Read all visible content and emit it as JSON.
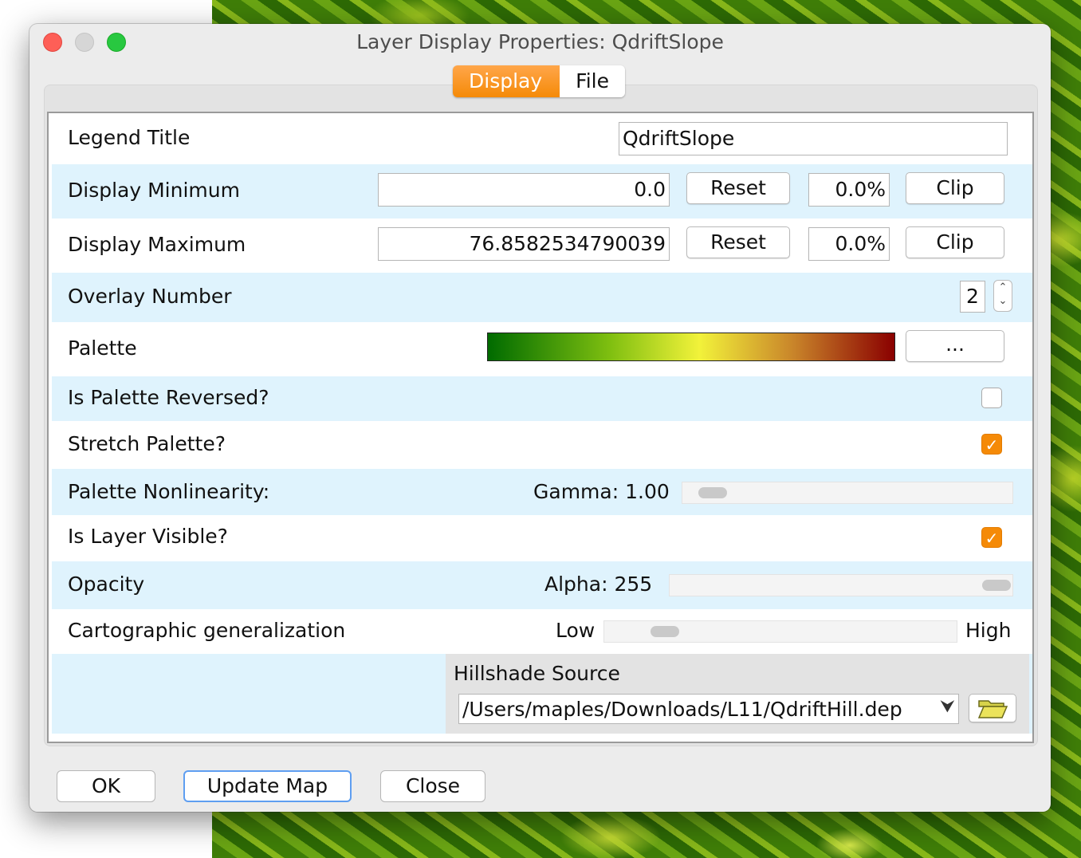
{
  "window": {
    "title": "Layer Display Properties: QdriftSlope"
  },
  "tabs": [
    {
      "label": "Display"
    },
    {
      "label": "File"
    }
  ],
  "legend_title": {
    "label": "Legend Title",
    "value": "QdriftSlope"
  },
  "display_minimum": {
    "label": "Display Minimum",
    "value": "0.0",
    "reset": "Reset",
    "percent": "0.0%",
    "clip": "Clip"
  },
  "display_maximum": {
    "label": "Display Maximum",
    "value": "76.8582534790039",
    "reset": "Reset",
    "percent": "0.0%",
    "clip": "Clip"
  },
  "overlay_number": {
    "label": "Overlay Number",
    "value": "2"
  },
  "palette": {
    "label": "Palette",
    "button": "...",
    "colors": [
      "#006b00",
      "#f2f23a",
      "#8a0000"
    ]
  },
  "palette_reversed": {
    "label": "Is Palette Reversed?",
    "checked": false
  },
  "stretch_palette": {
    "label": "Stretch Palette?",
    "checked": true
  },
  "palette_nonlinearity": {
    "label": "Palette Nonlinearity:",
    "gamma_text": "Gamma: 1.00"
  },
  "layer_visible": {
    "label": "Is Layer Visible?",
    "checked": true
  },
  "opacity": {
    "label": "Opacity",
    "alpha_text": "Alpha: 255"
  },
  "generalization": {
    "label": "Cartographic generalization",
    "low": "Low",
    "high": "High"
  },
  "hillshade": {
    "label": "Hillshade Source",
    "value": "/Users/maples/Downloads/L11/QdriftHill.dep"
  },
  "buttons": {
    "ok": "OK",
    "update_map": "Update Map",
    "close": "Close"
  },
  "colors": {
    "accent": "#f58a07",
    "row_alt": "#dff3fd"
  }
}
